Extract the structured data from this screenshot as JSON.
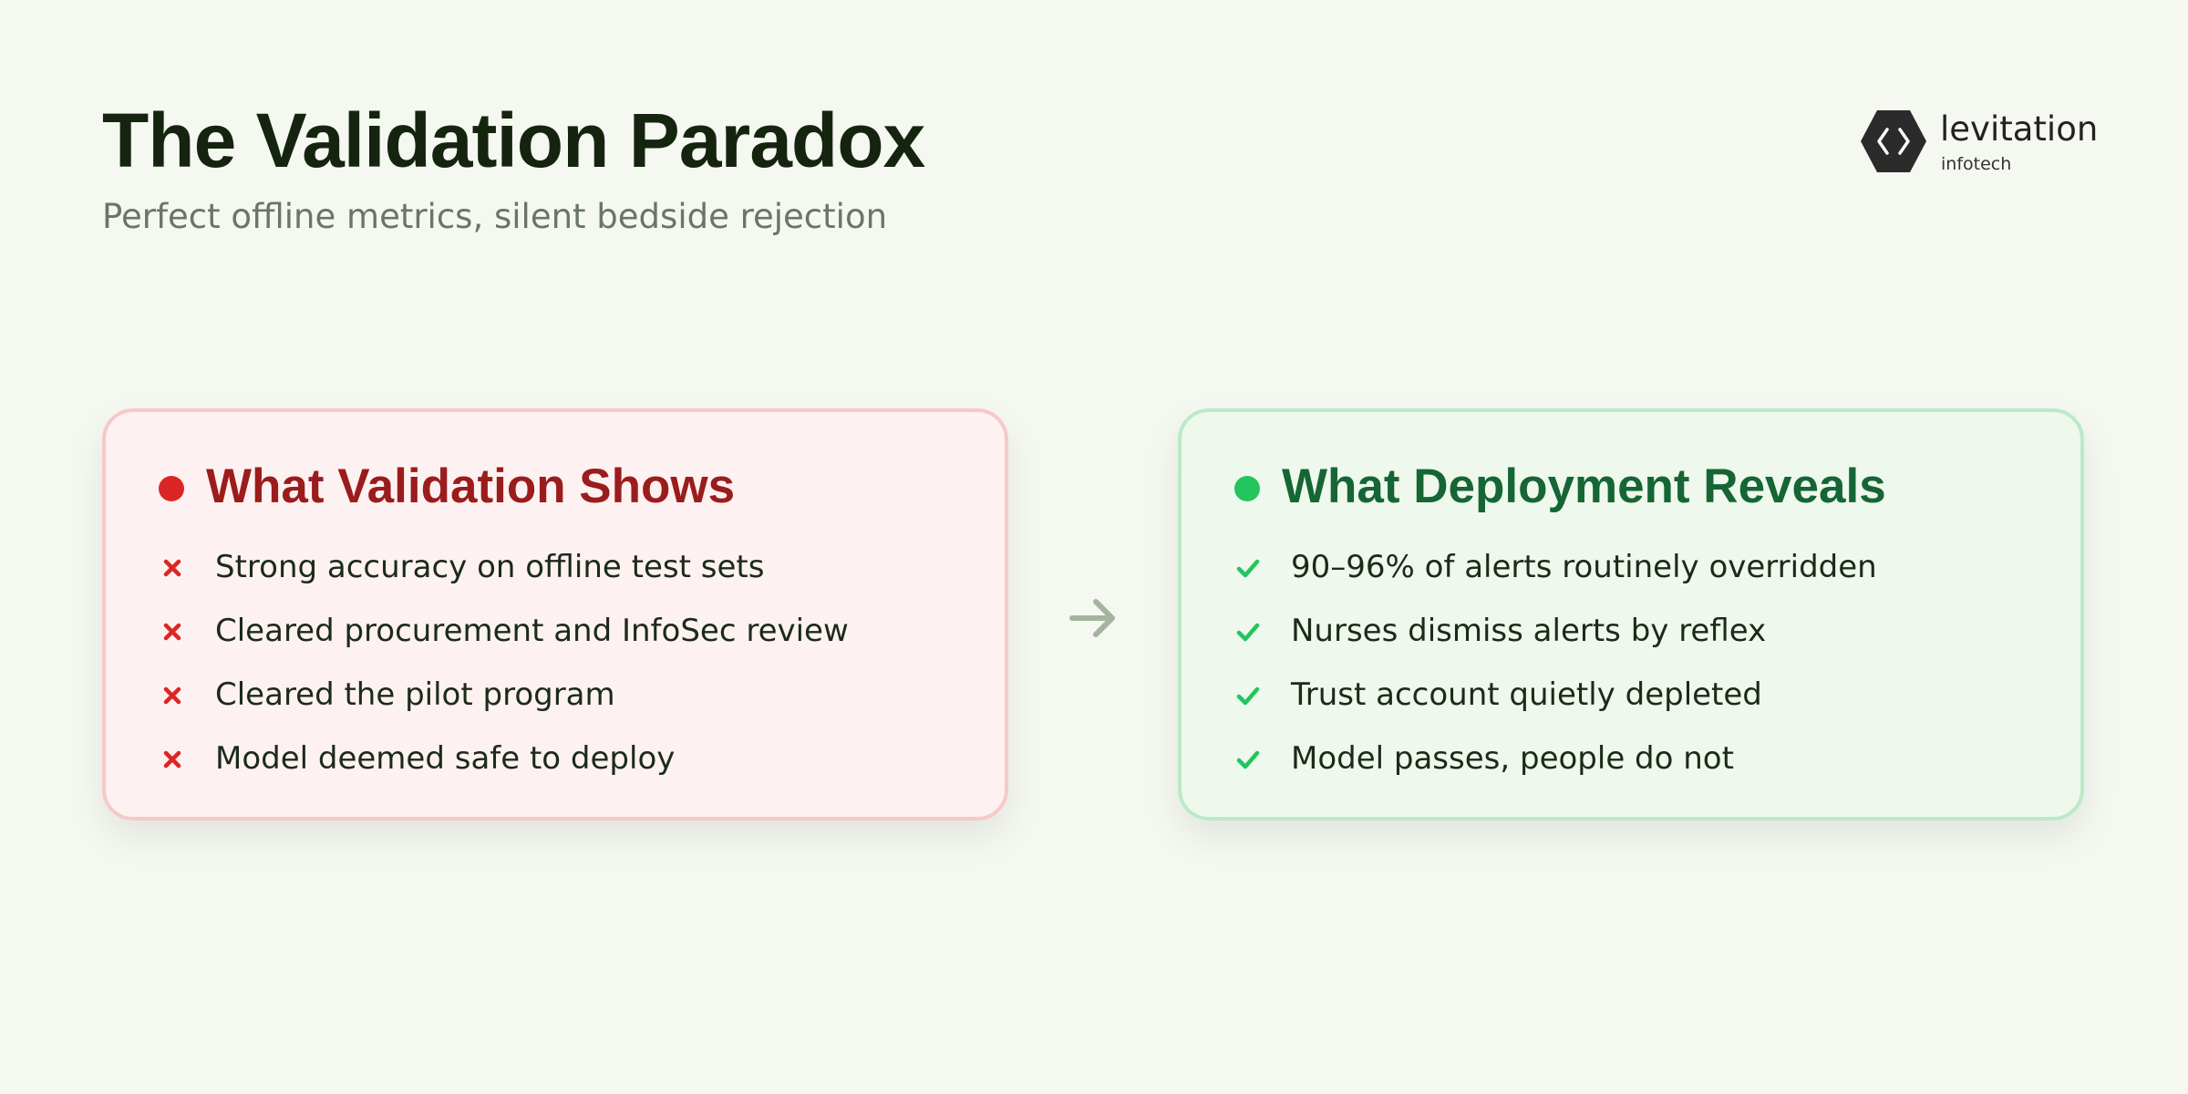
{
  "slide": {
    "title": "The Validation Paradox",
    "subtitle": "Perfect offline metrics, silent bedside rejection"
  },
  "logo": {
    "name": "levitation",
    "sub": "infotech",
    "icon": "hexagon-code-icon"
  },
  "left_card": {
    "title": "What Validation Shows",
    "accent": "#dc2626",
    "title_color": "#9b1c1c",
    "item_icon": "x-mark-icon",
    "items": [
      "Strong accuracy on offline test sets",
      "Cleared procurement and InfoSec review",
      "Cleared the pilot program",
      "Model deemed safe to deploy"
    ]
  },
  "right_card": {
    "title": "What Deployment Reveals",
    "accent": "#22c55e",
    "title_color": "#166534",
    "item_icon": "check-mark-icon",
    "items": [
      "90–96% of alerts routinely overridden",
      "Nurses dismiss alerts by reflex",
      "Trust account quietly depleted",
      "Model passes, people do not"
    ]
  },
  "connector": {
    "icon": "arrow-right-icon"
  }
}
